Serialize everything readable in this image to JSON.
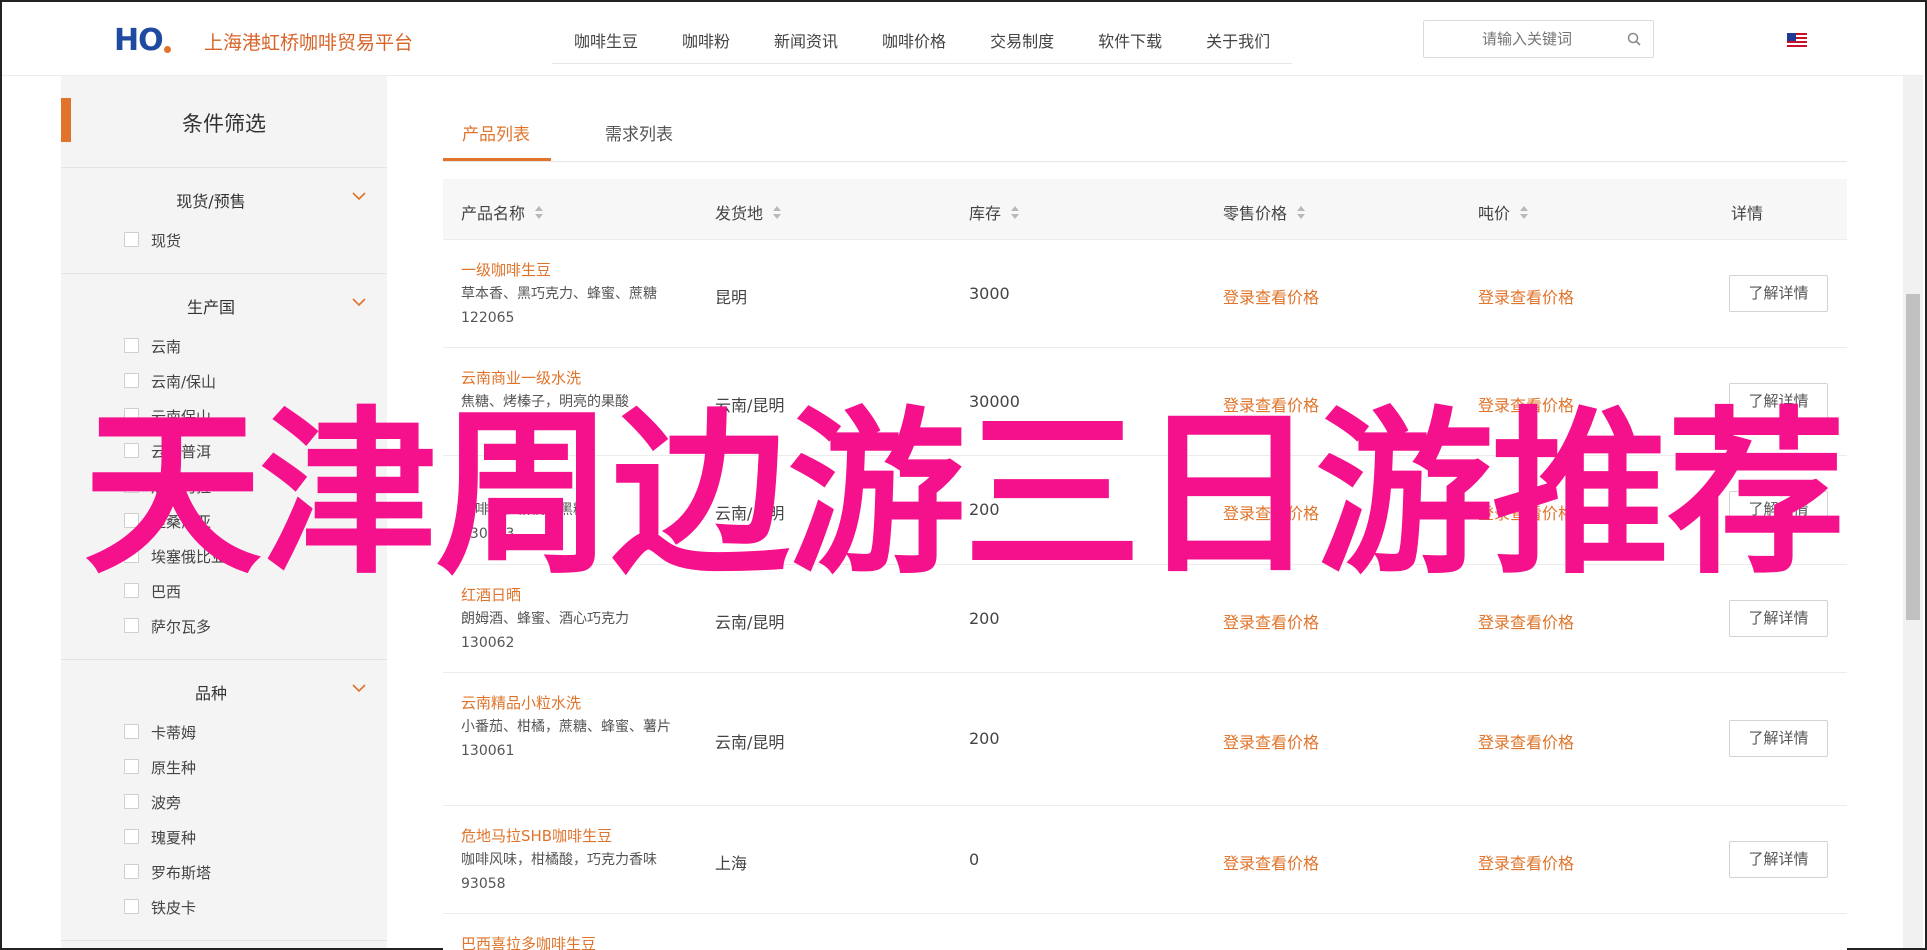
{
  "header": {
    "logo_text": "HO",
    "site_name": "上海港虹桥咖啡贸易平台",
    "nav": [
      "咖啡生豆",
      "咖啡粉",
      "新闻资讯",
      "咖啡价格",
      "交易制度",
      "软件下载",
      "关于我们"
    ],
    "search_placeholder": "请输入关键词",
    "flag_icon": "us-flag-icon"
  },
  "sidebar": {
    "title": "条件筛选",
    "sections": [
      {
        "label": "现货/预售",
        "options": [
          "现货"
        ]
      },
      {
        "label": "生产国",
        "options": [
          "云南",
          "云南/保山",
          "云南保山",
          "云南普洱",
          "危地马拉",
          "坦桑尼亚",
          "埃塞俄比亚",
          "巴西",
          "萨尔瓦多"
        ]
      },
      {
        "label": "品种",
        "options": [
          "卡蒂姆",
          "原生种",
          "波旁",
          "瑰夏种",
          "罗布斯塔",
          "铁皮卡"
        ]
      }
    ]
  },
  "main": {
    "tabs": [
      "产品列表",
      "需求列表"
    ],
    "columns": [
      "产品名称",
      "发货地",
      "库存",
      "零售价格",
      "吨价",
      "详情"
    ],
    "rows": [
      {
        "name": "一级咖啡生豆",
        "desc": "草本香、黑巧克力、蜂蜜、蔗糖",
        "id": "122065",
        "origin": "昆明",
        "stock": "3000",
        "retail": "登录查看价格",
        "ton": "登录查看价格",
        "btn": "了解详情"
      },
      {
        "name": "云南商业一级水洗",
        "desc": "焦糖、烤榛子，明亮的果酸",
        "id": "",
        "origin": "云南/昆明",
        "stock": "30000",
        "retail": "登录查看价格",
        "ton": "登录查看价格",
        "btn": "了解详情"
      },
      {
        "name": "",
        "desc": "咖啡香、柑橘、黑糖",
        "id": "130063",
        "origin": "云南/昆明",
        "stock": "200",
        "retail": "登录查看价格",
        "ton": "登录查看价格",
        "btn": "了解详情"
      },
      {
        "name": "红酒日晒",
        "desc": "朗姆酒、蜂蜜、酒心巧克力",
        "id": "130062",
        "origin": "云南/昆明",
        "stock": "200",
        "retail": "登录查看价格",
        "ton": "登录查看价格",
        "btn": "了解详情"
      },
      {
        "name": "云南精品小粒水洗",
        "desc": "小番茄、柑橘，蔗糖、蜂蜜、薯片",
        "id": "130061",
        "origin": "云南/昆明",
        "stock": "200",
        "retail": "登录查看价格",
        "ton": "登录查看价格",
        "btn": "了解详情"
      },
      {
        "name": "危地马拉SHB咖啡生豆",
        "desc": "咖啡风味，柑橘酸，巧克力香味",
        "id": "93058",
        "origin": "上海",
        "stock": "0",
        "retail": "登录查看价格",
        "ton": "登录查看价格",
        "btn": "了解详情"
      },
      {
        "name": "巴西喜拉多咖啡生豆",
        "desc": "",
        "id": "",
        "origin": "",
        "stock": "",
        "retail": "",
        "ton": "",
        "btn": ""
      }
    ]
  },
  "overlay_text": "天津周边游三日游推荐",
  "colors": {
    "accent": "#e0742b",
    "overlay": "#f5108c",
    "logo": "#1e4aa0"
  }
}
